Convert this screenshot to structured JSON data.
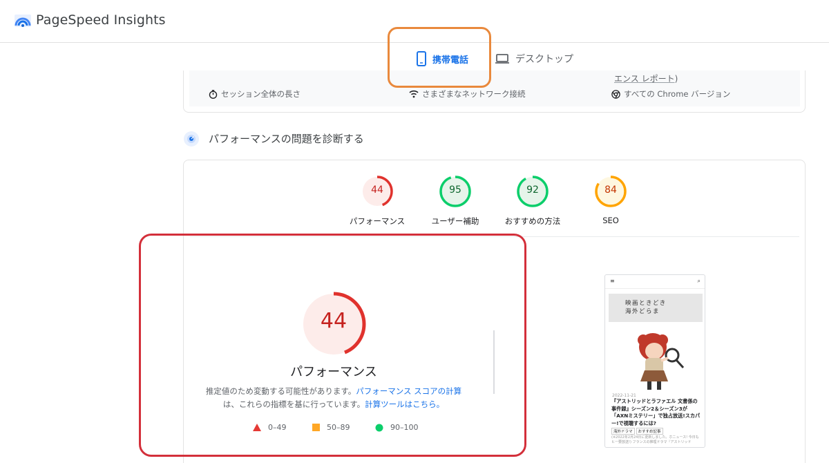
{
  "header": {
    "app_title": "PageSpeed Insights",
    "logo_icon": "pagespeed-logo-icon"
  },
  "device_tabs": [
    {
      "label": "携帯電話",
      "icon": "smartphone-icon",
      "selected": true
    },
    {
      "label": "デスクトップ",
      "icon": "laptop-icon",
      "selected": false
    }
  ],
  "crux": {
    "items": [
      {
        "label": "セッション全体の長さ",
        "icon": "timer-icon"
      },
      {
        "label": "さまざまなネットワーク接続",
        "icon": "wifi-icon"
      },
      {
        "label": "すべての Chrome バージョン",
        "icon": "chrome-icon"
      }
    ],
    "link_text": "エンス レポート",
    "link_suffix": ")"
  },
  "diagnose": {
    "title": "パフォーマンスの問題を診断する",
    "icon": "lighthouse-icon"
  },
  "gauges": [
    {
      "label": "パフォーマンス",
      "score": "44",
      "value": 44,
      "color": "#e0322d",
      "bg": "#fdecea",
      "text": "#c5221f"
    },
    {
      "label": "ユーザー補助",
      "score": "95",
      "value": 95,
      "color": "#0cce6b",
      "bg": "#e6f4ea",
      "text": "#0d652d"
    },
    {
      "label": "おすすめの方法",
      "score": "92",
      "value": 92,
      "color": "#0cce6b",
      "bg": "#e6f4ea",
      "text": "#0d652d"
    },
    {
      "label": "SEO",
      "score": "84",
      "value": 84,
      "color": "#ffa400",
      "bg": "#fef7e0",
      "text": "#c33300"
    }
  ],
  "performance": {
    "score": "44",
    "value": 44,
    "label": "パフォーマンス",
    "desc_part1": "推定値のため変動する可能性があります。",
    "desc_link1": "パフォーマンス スコアの計算",
    "desc_part2": "は、これらの指標を基に行っています。",
    "desc_link2": "計算ツールはこちら。"
  },
  "legend": [
    {
      "range": "0–49",
      "shape": "triangle",
      "color": "#e53935"
    },
    {
      "range": "50–89",
      "shape": "square",
      "color": "#ffa726"
    },
    {
      "range": "90–100",
      "shape": "circle",
      "color": "#0cce6b"
    }
  ],
  "thumbnail": {
    "menu_icon": "≡",
    "search_icon": "⌕",
    "brand_line1": "映画ときどき",
    "brand_line2": "海外どらま",
    "date": "2022-11-21",
    "headline": "『アストリッドとラファエル 文書係の事件録』シーズン2＆シーズン3が「AXNミステリー」で独占放送!スカパー!で視聴するには?",
    "tags": [
      "海外ドラマ",
      "おすすめ記事"
    ],
    "excerpt": "(※2022年2月24日に更新しました。ホニュース! 今日もヒー要放送!) フランスの推理ドラマ『アストリッド"
  },
  "annotations": {
    "highlight_orange": "#e9893c",
    "highlight_red": "#d32f3a"
  }
}
